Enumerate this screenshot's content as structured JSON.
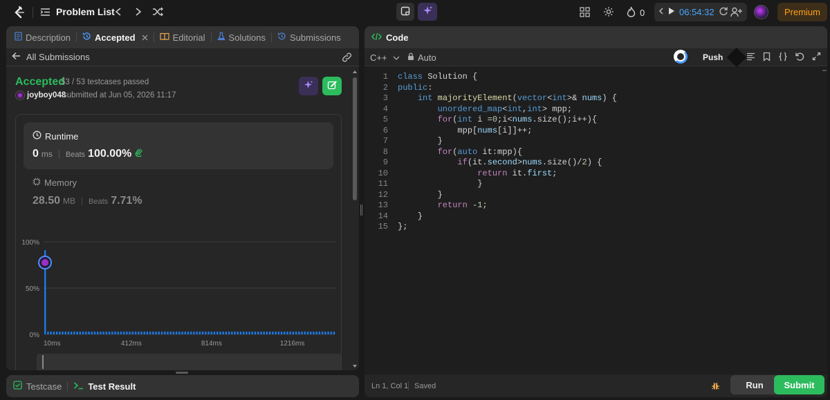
{
  "topbar": {
    "problem_list": "Problem List",
    "streak_count": "0",
    "timer": "06:54:32",
    "premium": "Premium"
  },
  "left_tabs": [
    "Description",
    "Accepted",
    "Editorial",
    "Solutions",
    "Submissions"
  ],
  "submission": {
    "back_label": "All Submissions",
    "status": "Accepted",
    "testcases": "53 / 53 testcases passed",
    "user": "joyboy048",
    "submitted_at": "submitted at Jun 05, 2026 11:17",
    "runtime_label": "Runtime",
    "runtime_value": "0",
    "runtime_unit": "ms",
    "beats_label": "Beats",
    "runtime_beats": "100.00%",
    "memory_label": "Memory",
    "memory_value": "28.50",
    "memory_unit": "MB",
    "memory_beats": "7.71%"
  },
  "chart_data": {
    "type": "bar",
    "y_ticks": [
      "100%",
      "50%",
      "0%"
    ],
    "x_ticks": [
      "10ms",
      "412ms",
      "814ms",
      "1216ms"
    ],
    "ylim": [
      0,
      100
    ],
    "highlight": {
      "x": "10ms",
      "value": 91
    },
    "values": [
      91,
      3,
      3,
      3,
      3,
      3,
      3,
      3,
      3,
      3,
      3,
      3,
      3,
      3,
      3,
      3,
      3,
      3,
      3,
      3,
      3,
      3,
      3,
      3,
      3,
      3,
      3,
      3,
      3,
      3,
      3,
      3,
      3,
      3,
      3,
      3,
      3,
      3,
      3,
      3,
      3,
      3,
      3,
      3,
      3,
      3,
      3,
      3,
      3,
      3,
      3,
      3,
      3,
      3,
      3,
      3,
      3,
      3,
      3,
      3,
      3,
      3,
      3,
      3,
      3,
      3,
      3,
      3,
      3,
      3,
      3,
      3,
      3,
      3,
      3,
      3,
      3,
      3,
      3,
      3,
      3,
      3,
      3,
      3,
      3,
      3,
      3,
      3,
      3,
      3,
      3,
      3,
      3,
      3,
      3,
      3,
      3,
      3,
      3,
      3
    ]
  },
  "bottom_tabs": {
    "testcase": "Testcase",
    "test_result": "Test Result"
  },
  "editor": {
    "title": "Code",
    "language": "C++",
    "mode": "Auto",
    "push": "Push",
    "status_pos": "Ln 1, Col 1",
    "status_saved": "Saved",
    "run": "Run",
    "submit": "Submit"
  },
  "code_lines": [
    "class Solution {",
    "public:",
    "    int majorityElement(vector<int>& nums) {",
    "        unordered_map<int,int> mpp;",
    "        for(int i =0;i<nums.size();i++){",
    "            mpp[nums[i]]++;",
    "        }",
    "        for(auto it:mpp){",
    "            if(it.second>nums.size()/2) {",
    "                return it.first;",
    "                }",
    "        }",
    "        return -1;",
    "    }",
    "};"
  ],
  "colors": {
    "accent_green": "#2cbb5d",
    "accent_blue": "#1a90ff",
    "premium": "#ffa116",
    "bar": "#1a7cf0"
  }
}
